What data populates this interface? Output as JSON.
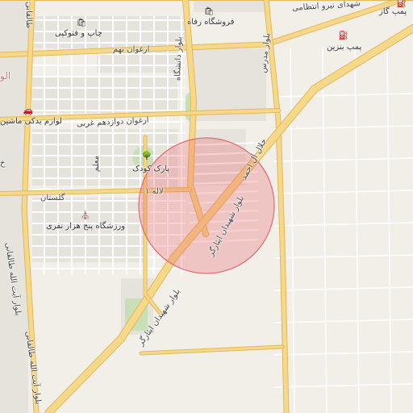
{
  "map": {
    "center_radius_label": "",
    "colors": {
      "background": "#f2efe9",
      "major_road": "#f6d88a",
      "major_road_casing": "#e2b85a",
      "minor_road": "#ffffff",
      "block": "#e6e3dd",
      "park": "#c9dfb8",
      "highlight_circle": "rgba(235,90,100,0.28)",
      "highlight_stroke": "#e26b72"
    }
  },
  "labels": {
    "shohada_niroo": "شهدای نیرو انتظامی",
    "pomp_gaz": "پمپ گاز",
    "pomp_benzin": "پمپ بنزین",
    "foroushgah": "فروشگاه رفاه",
    "chap": "چاپ و فتوکپی",
    "arghavan_noh": "ارغوان نهم",
    "arghavan_12": "ارغوان دوازدهم غربی",
    "lavazem": "لوازم یدکی ماشین",
    "park_kudak": "پارک کودک",
    "lale": "لاله ۱",
    "golestan": "گلستان",
    "varzeshgah": "ورزشگاه پنج هزار نفری",
    "madrese": "بلوار مدرس",
    "danesh": "بلوار دانشگاه",
    "jalal": "جلال آل احمد",
    "shahidan_1": "بلوار شهیدان ایثارگر",
    "shahidan_2": "بلوار شهیدان ایثارگر",
    "taleghani_1": "بلوار آیت الله طالقانی",
    "taleghani_2": "بلوار آیت الله طالقانی",
    "taleghani_3": "طالقانی",
    "moallem": "معلم",
    "al_mousavi": "الو",
    "kh": "خ"
  }
}
